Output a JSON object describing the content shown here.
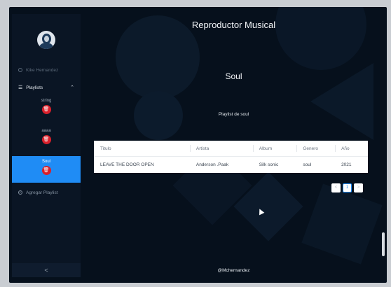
{
  "app_title": "Reproductor Musical",
  "sidebar": {
    "user_name": "Kike Hernandez",
    "playlists_label": "Playlists",
    "playlists": [
      {
        "name": "string"
      },
      {
        "name": "aaaa"
      },
      {
        "name": "Soul",
        "active": true
      }
    ],
    "add_playlist_label": "Agregar Playlist",
    "collapse_glyph": "<"
  },
  "main": {
    "playlist_title": "Soul",
    "playlist_description": "Playlist de soul",
    "table": {
      "columns": [
        "Titulo",
        "Artista",
        "Album",
        "Genero",
        "Año"
      ],
      "rows": [
        [
          "LEAVE THE DOOR OPEN",
          "Anderson .Paak",
          "Silk sonic",
          "soul",
          "2021"
        ]
      ]
    },
    "pagination": {
      "prev": "<",
      "current": "1",
      "next": ">"
    },
    "footer": "@Mchernandez"
  },
  "icons": {
    "user": "user-icon",
    "list": "list-icon",
    "chevron": "chevron-up-icon",
    "trash": "trash-icon",
    "add": "plus-circle-icon"
  },
  "colors": {
    "background": "#06101c",
    "sidebar": "#0a1524",
    "accent": "#1f8cf5",
    "delete": "#d9202b"
  }
}
